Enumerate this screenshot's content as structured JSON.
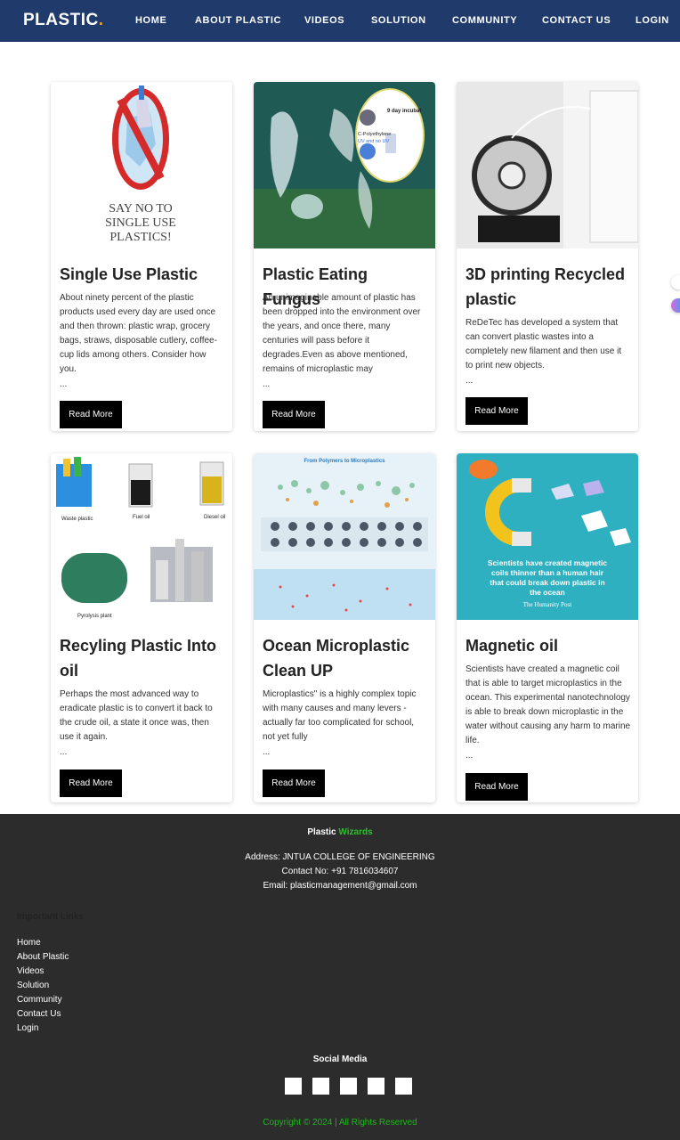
{
  "nav": {
    "brand": "PLASTIC",
    "brand_dot": ".",
    "links": [
      "HOME",
      "ABOUT PLASTIC",
      "VIDEOS",
      "SOLUTION",
      "COMMUNITY",
      "CONTACT US",
      "LOGIN"
    ]
  },
  "cards": [
    {
      "title": "Single Use Plastic",
      "text": "About ninety percent of the plastic products used every day are used once and then thrown: plastic wrap, grocery bags, straws, disposable cutlery, coffee-cup lids among others. Consider how you.",
      "ellipsis": "...",
      "button": "Read More",
      "image_text": [
        "SAY NO TO",
        "SINGLE USE",
        "PLASTICS!"
      ]
    },
    {
      "title": "Plastic Eating Fungus",
      "text": "An unimaginable amount of plastic has been dropped into the environment over the years, and once there, many centuries will pass before it degrades.Even as above mentioned, remains of microplastic may",
      "ellipsis": "...",
      "button": "Read More",
      "image_text": [
        "9 day incubat",
        "C-Polyethylene",
        "UV and no UV"
      ]
    },
    {
      "title": "3D printing Recycled plastic",
      "text": "ReDeTec has developed a system that can convert plastic wastes into a completely new filament and then use it to print new objects.",
      "ellipsis": "...",
      "button": "Read More"
    },
    {
      "title": "Recyling Plastic Into oil",
      "text": "Perhaps the most advanced way to eradicate plastic is to convert it back to the crude oil, a state it once was, then use it again.",
      "ellipsis": "...",
      "button": "Read More",
      "image_text": [
        "Waste plastic",
        "Fuel oil",
        "Diesel oil",
        "Pyrolysis plant"
      ]
    },
    {
      "title": "Ocean Microplastic Clean UP",
      "text": "Microplastics\" is a highly complex topic with many causes and many levers - actually far too complicated for school, not yet fully",
      "ellipsis": "...",
      "button": "Read More",
      "image_text": [
        "From Polymers to Microplastics"
      ]
    },
    {
      "title": "Magnetic oil",
      "text": "Scientists have created a magnetic coil that is able to target microplastics in the ocean. This experimental nanotechnology is able to break down microplastic in the water without causing any harm to marine life.",
      "ellipsis": "...",
      "button": "Read More",
      "image_text": [
        "Scientists have created magnetic",
        "coils thinner than a human hair",
        "that could break down plastic in",
        "the ocean",
        "The Humanity Post"
      ]
    }
  ],
  "footer": {
    "brand_a": "Plastic",
    "brand_b": "Wizards",
    "address": "Address: JNTUA COLLEGE OF ENGINEERING",
    "contact": "Contact No: +91 7816034607",
    "email": "Email: plasticmanagement@gmail.com",
    "links_heading": "Important Links",
    "links": [
      "Home",
      "About Plastic",
      "Videos",
      "Solution",
      "Community",
      "Contact Us",
      "Login"
    ],
    "social_heading": "Social Media",
    "copyright": "Copyright © 2024 | All Rights Reserved"
  },
  "colors": {
    "navbar": "#1f3a6b",
    "footer": "#2c2c2c",
    "accent_green": "#2fbf2f",
    "button": "#000000"
  }
}
